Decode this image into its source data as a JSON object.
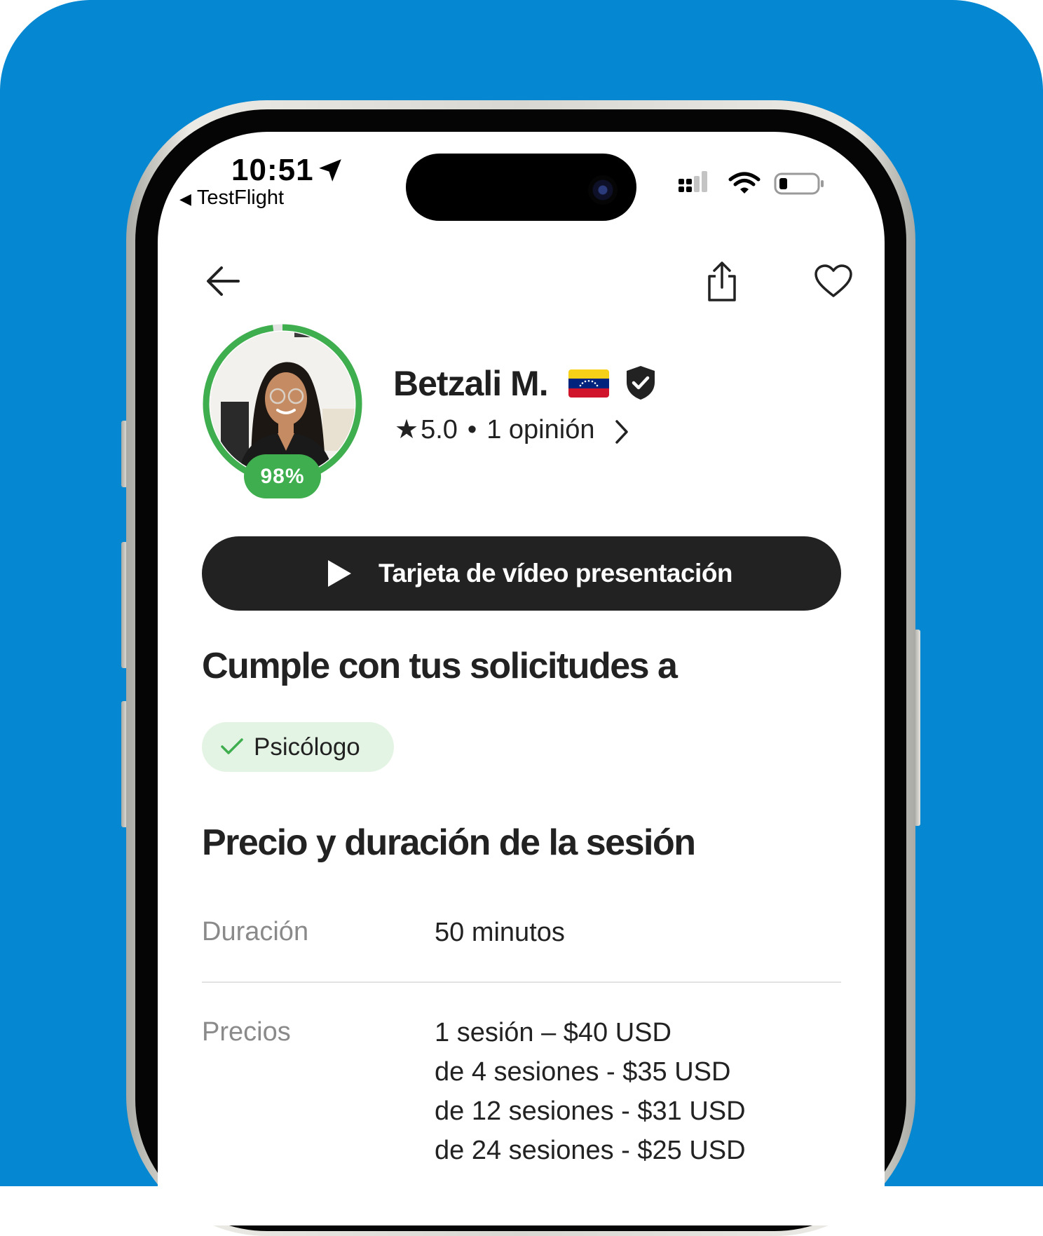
{
  "status_bar": {
    "time": "10:51",
    "back_app": "TestFlight"
  },
  "profile": {
    "name": "Betzali M.",
    "match_percent": "98%",
    "match_level": 0.98,
    "rating": "5.0",
    "separator": "•",
    "reviews": "1 opinión",
    "flag_colors": [
      "#f7d117",
      "#00247d",
      "#cf142b"
    ],
    "accent_color": "#3fae4f"
  },
  "video_button": {
    "label": "Tarjeta de vídeo presentación"
  },
  "requests": {
    "heading": "Cumple con tus solicitudes a",
    "chip_label": "Psicólogo"
  },
  "pricing": {
    "heading": "Precio y duración de la sesión",
    "duration_label": "Duración",
    "duration_value": "50 minutos",
    "prices_label": "Precios",
    "price_lines": [
      "1 sesión – $40 USD",
      "de 4 sesiones - $35 USD",
      "de 12 sesiones - $31 USD",
      "de 24 sesiones - $25 USD"
    ]
  },
  "icons": [
    "location-arrow-icon",
    "signal-icon",
    "wifi-icon",
    "battery-icon",
    "back-arrow-icon",
    "share-icon",
    "heart-icon",
    "verified-shield-icon",
    "star-icon",
    "chevron-right-icon",
    "play-icon",
    "check-icon"
  ]
}
